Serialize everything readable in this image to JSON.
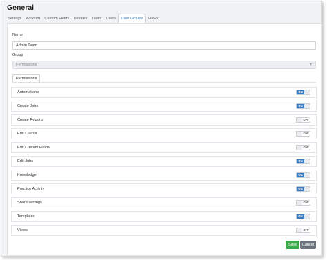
{
  "page": {
    "title": "General"
  },
  "tabs": [
    {
      "label": "Settings"
    },
    {
      "label": "Account"
    },
    {
      "label": "Custom Fields"
    },
    {
      "label": "Devices"
    },
    {
      "label": "Tasks"
    },
    {
      "label": "Users"
    },
    {
      "label": "User Groups"
    },
    {
      "label": "Views"
    }
  ],
  "active_tab": "User Groups",
  "form": {
    "name_label": "Name",
    "name_value": "Admin Team",
    "group_label": "Group",
    "group_value": "Permissions"
  },
  "permissions_tab": {
    "label": "Permissions"
  },
  "permissions": [
    {
      "name": "Automations",
      "state": "ON"
    },
    {
      "name": "Create Jobs",
      "state": "ON"
    },
    {
      "name": "Create Reports",
      "state": "OFF"
    },
    {
      "name": "Edit Clients",
      "state": "OFF"
    },
    {
      "name": "Edit Custom Fields",
      "state": "OFF"
    },
    {
      "name": "Edit Jobs",
      "state": "ON"
    },
    {
      "name": "Knowledge",
      "state": "ON"
    },
    {
      "name": "Practice Activity",
      "state": "ON"
    },
    {
      "name": "Share settings",
      "state": "OFF"
    },
    {
      "name": "Templates",
      "state": "ON"
    },
    {
      "name": "Views",
      "state": "OFF"
    }
  ],
  "actions": {
    "save_label": "Save",
    "cancel_label": "Cancel"
  },
  "colors": {
    "accent": "#3b7bbf",
    "save": "#3aa84b",
    "cancel": "#6c757d"
  }
}
